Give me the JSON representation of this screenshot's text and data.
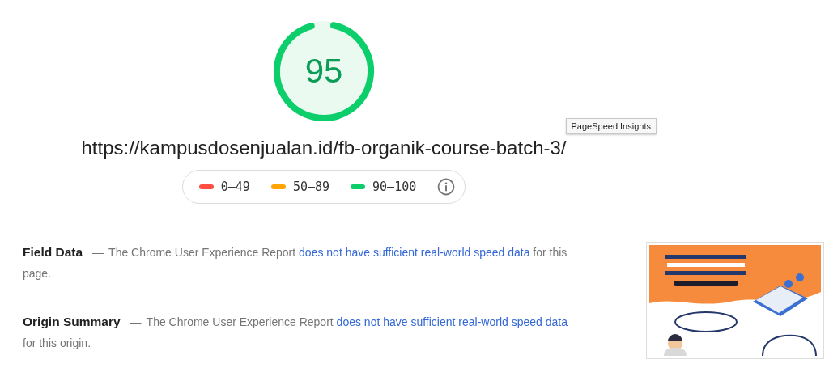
{
  "score": {
    "value": "95"
  },
  "url": "https://kampusdosenjualan.id/fb-organik-course-batch-3/",
  "tooltip": "PageSpeed Insights",
  "legend": [
    {
      "label": "0–49",
      "color": "#ff4e42"
    },
    {
      "label": "50–89",
      "color": "#ffa400"
    },
    {
      "label": "90–100",
      "color": "#0cce6b"
    }
  ],
  "sections": [
    {
      "title": "Field Data",
      "dash": "—",
      "before": "The Chrome User Experience Report",
      "link": "does not have sufficient real-world speed data",
      "after": "for this page."
    },
    {
      "title": "Origin Summary",
      "dash": "—",
      "before": "The Chrome User Experience Report",
      "link": "does not have sufficient real-world speed data",
      "after": "for this origin."
    }
  ]
}
